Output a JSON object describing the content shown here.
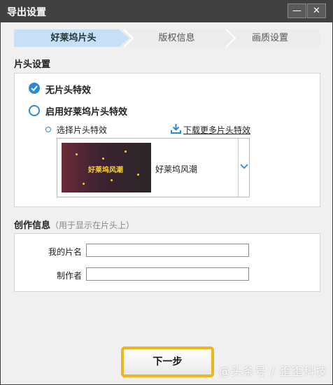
{
  "window": {
    "title": "导出设置",
    "minimize_glyph": "—",
    "close_glyph": "✕"
  },
  "steps": [
    {
      "label": "好莱坞片头",
      "active": true
    },
    {
      "label": "版权信息",
      "active": false
    },
    {
      "label": "画质设置",
      "active": false
    }
  ],
  "intro": {
    "section_title": "片头设置",
    "option_none": "无片头特效",
    "option_enable": "启用好莱坞片头特效",
    "select_label": "选择片头特效",
    "download_link": "下载更多片头特效",
    "selected_effect": {
      "thumb_text": "好莱坞风潮",
      "name": "好莱坞风潮"
    }
  },
  "credits": {
    "section_title": "创作信息",
    "section_hint": "（用于显示在片头上）",
    "title_label": "我的片名",
    "title_value": "",
    "author_label": "制作者",
    "author_value": ""
  },
  "footer": {
    "next_label": "下一步"
  },
  "watermark": "@头条号 / 歪歪科技",
  "colors": {
    "accent": "#2a8ad8",
    "active_step": "#c7e0f6",
    "highlight": "#f0b51b",
    "titlebar": "#414141"
  }
}
